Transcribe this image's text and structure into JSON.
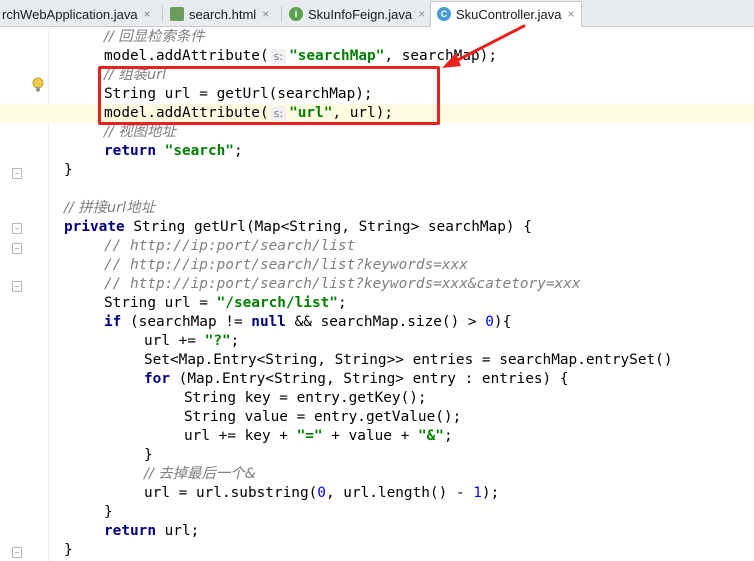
{
  "tabs": [
    {
      "label": "rchWebApplication.java",
      "icon": "java-class-icon",
      "closable": true
    },
    {
      "label": "search.html",
      "icon": "html-file-icon",
      "closable": true
    },
    {
      "label": "SkuInfoFeign.java",
      "icon": "interface-icon",
      "closable": true
    },
    {
      "label": "SkuController.java",
      "icon": "class-icon",
      "closable": true,
      "active": true
    }
  ],
  "tab_close_glyph": "×",
  "icon_letters": {
    "interface": "I",
    "class": "C"
  },
  "param_hint": "s:",
  "code": {
    "l1": "// 回显检索条件",
    "l2_a": "model.addAttribute(",
    "l2_str": "\"searchMap\"",
    "l2_b": ", searchMap);",
    "l3": "// 组装url",
    "l4": "String url = getUrl(searchMap);",
    "l5_a": "model.addAttribute(",
    "l5_str": "\"url\"",
    "l5_b": ", url);",
    "l6": "// 视图地址",
    "l7_kw": "return",
    "l7_str": "\"search\"",
    "l7_end": ";",
    "l8": "}",
    "l10": "// 拼接url地址",
    "l11_kw": "private",
    "l11_rest": " String getUrl(Map<String, String> searchMap) {",
    "l12": "// http://ip:port/search/list",
    "l13": "// http://ip:port/search/list?keywords=xxx",
    "l14": "// http://ip:port/search/list?keywords=xxx&catetory=xxx",
    "l15_a": "String url = ",
    "l15_str": "\"/search/list\"",
    "l15_end": ";",
    "l16_kw": "if",
    "l16_a": " (searchMap != ",
    "l16_null": "null",
    "l16_b": " && searchMap.size() > ",
    "l16_num": "0",
    "l16_end": "){",
    "l17_a": "url += ",
    "l17_str": "\"?\"",
    "l17_end": ";",
    "l18": "Set<Map.Entry<String, String>> entries = searchMap.entrySet()",
    "l19_kw": "for",
    "l19_rest": " (Map.Entry<String, String> entry : entries) {",
    "l20": "String key = entry.getKey();",
    "l21": "String value = entry.getValue();",
    "l22_a": "url += key + ",
    "l22_s1": "\"=\"",
    "l22_b": " + value + ",
    "l22_s2": "\"&\"",
    "l22_end": ";",
    "l23": "}",
    "l24": "// 去掉最后一个&",
    "l25_a": "url = url.substring(",
    "l25_n1": "0",
    "l25_b": ", url.length() - ",
    "l25_n2": "1",
    "l25_end": ");",
    "l26": "}",
    "l27_kw": "return",
    "l27_rest": " url;",
    "l28": "}"
  },
  "colors": {
    "annotation": "#e8211d",
    "keyword": "#000080",
    "string": "#008000",
    "comment": "#808080",
    "number": "#0000ff"
  }
}
